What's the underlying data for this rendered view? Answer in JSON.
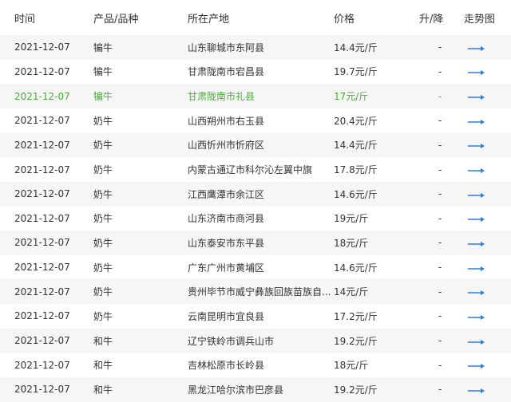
{
  "headers": {
    "date": "时间",
    "product": "产品/品种",
    "origin": "所在产地",
    "price": "价格",
    "change": "升/降",
    "trend": "走势图"
  },
  "colors": {
    "highlight_text": "#4aab3a",
    "trend_arrow": "#2f7de1",
    "alt_row": "#f6f6f6"
  },
  "trend_icon": "arrow-right-icon",
  "rows": [
    {
      "date": "2021-12-07",
      "product": "犏牛",
      "origin": "山东聊城市东阿县",
      "price": "14.4元/斤",
      "change": "-"
    },
    {
      "date": "2021-12-07",
      "product": "犏牛",
      "origin": "甘肃陇南市宕昌县",
      "price": "19.7元/斤",
      "change": "-"
    },
    {
      "date": "2021-12-07",
      "product": "犏牛",
      "origin": "甘肃陇南市礼县",
      "price": "17元/斤",
      "change": "-"
    },
    {
      "date": "2021-12-07",
      "product": "奶牛",
      "origin": "山西朔州市右玉县",
      "price": "20.4元/斤",
      "change": "-"
    },
    {
      "date": "2021-12-07",
      "product": "奶牛",
      "origin": "山西忻州市忻府区",
      "price": "14.4元/斤",
      "change": "-"
    },
    {
      "date": "2021-12-07",
      "product": "奶牛",
      "origin": "内蒙古通辽市科尔沁左翼中旗",
      "price": "17.8元/斤",
      "change": "-"
    },
    {
      "date": "2021-12-07",
      "product": "奶牛",
      "origin": "江西鹰潭市余江区",
      "price": "14.6元/斤",
      "change": "-"
    },
    {
      "date": "2021-12-07",
      "product": "奶牛",
      "origin": "山东济南市商河县",
      "price": "19元/斤",
      "change": "-"
    },
    {
      "date": "2021-12-07",
      "product": "奶牛",
      "origin": "山东泰安市东平县",
      "price": "18元/斤",
      "change": "-"
    },
    {
      "date": "2021-12-07",
      "product": "奶牛",
      "origin": "广东广州市黄埔区",
      "price": "14.6元/斤",
      "change": "-"
    },
    {
      "date": "2021-12-07",
      "product": "奶牛",
      "origin": "贵州毕节市威宁彝族回族苗族自...",
      "price": "14元/斤",
      "change": "-"
    },
    {
      "date": "2021-12-07",
      "product": "奶牛",
      "origin": "云南昆明市宜良县",
      "price": "17.2元/斤",
      "change": "-"
    },
    {
      "date": "2021-12-07",
      "product": "和牛",
      "origin": "辽宁铁岭市调兵山市",
      "price": "19.2元/斤",
      "change": "-"
    },
    {
      "date": "2021-12-07",
      "product": "和牛",
      "origin": "吉林松原市长岭县",
      "price": "18元/斤",
      "change": "-"
    },
    {
      "date": "2021-12-07",
      "product": "和牛",
      "origin": "黑龙江哈尔滨市巴彦县",
      "price": "19.2元/斤",
      "change": "-"
    }
  ]
}
